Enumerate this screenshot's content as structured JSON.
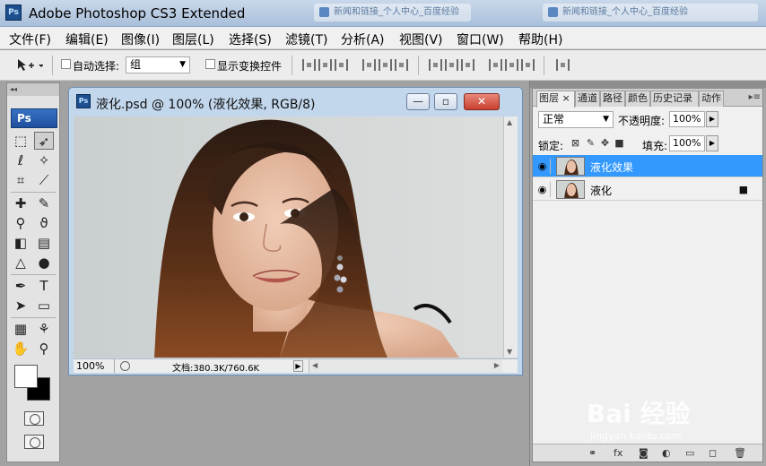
{
  "app": {
    "title": "Adobe Photoshop CS3 Extended",
    "icon_label": "Ps",
    "background_tabs": [
      "新闻和链接_个人中心_百度经验",
      "新闻和链接_个人中心_百度经验"
    ]
  },
  "menubar": {
    "items": [
      "文件(F)",
      "编辑(E)",
      "图像(I)",
      "图层(L)",
      "选择(S)",
      "滤镜(T)",
      "分析(A)",
      "视图(V)",
      "窗口(W)",
      "帮助(H)"
    ]
  },
  "options": {
    "tool_icon": "move-tool-icon",
    "auto_select_label": "自动选择:",
    "auto_select_value": "组",
    "show_transform_label": "显示变换控件"
  },
  "toolbox": {
    "logo": "Ps",
    "grip": "◂◂",
    "tools": [
      "marquee",
      "move",
      "lasso",
      "magic-wand",
      "crop",
      "slice",
      "healing-brush",
      "brush",
      "clone-stamp",
      "history-brush",
      "eraser",
      "gradient",
      "blur",
      "dodge",
      "pen",
      "type",
      "path-selection",
      "rectangle",
      "notes",
      "eyedropper",
      "hand",
      "zoom"
    ],
    "foreground_color": "#ffffff",
    "background_color": "#000000"
  },
  "document": {
    "title": "液化.psd @ 100% (液化效果, RGB/8)",
    "zoom": "100%",
    "doc_size": "文档:380.3K/760.6K",
    "minimize": "—",
    "maximize": "▫",
    "close": "✕"
  },
  "layers_panel": {
    "tabs": [
      "图层",
      "通道",
      "路径",
      "颜色",
      "历史记录",
      "动作"
    ],
    "tab_close": "×",
    "blend_mode": "正常",
    "opacity_label": "不透明度:",
    "opacity_value": "100%",
    "lock_label": "锁定:",
    "fill_label": "填充:",
    "fill_value": "100%",
    "layers": [
      {
        "name": "液化效果",
        "selected": true,
        "locked": false
      },
      {
        "name": "液化",
        "selected": false,
        "locked": true
      }
    ]
  },
  "watermark": {
    "text": "Bai 经验",
    "url": "jingyan.baidu.com"
  },
  "colors": {
    "selection": "#3399ff",
    "titlebar": "#b6c9e0",
    "close_button": "#c9402d"
  }
}
